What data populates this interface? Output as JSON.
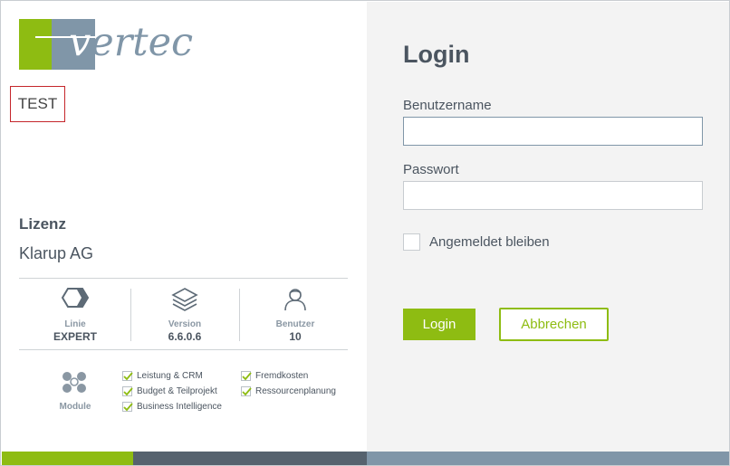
{
  "brand": {
    "wordmark_v": "v",
    "wordmark_rest": "ertec"
  },
  "environment": {
    "label": "TEST"
  },
  "license": {
    "heading": "Lizenz",
    "company": "Klarup AG",
    "stats": [
      {
        "label": "Linie",
        "value": "EXPERT",
        "icon": "hexagon-outline-icon"
      },
      {
        "label": "Version",
        "value": "6.6.0.6",
        "icon": "layers-icon"
      },
      {
        "label": "Benutzer",
        "value": "10",
        "icon": "user-icon"
      }
    ],
    "modules": {
      "label": "Module",
      "icon": "modules-hexagons-icon",
      "items_col1": [
        "Leistung & CRM",
        "Budget & Teilprojekt",
        "Business Intelligence"
      ],
      "items_col2": [
        "Fremdkosten",
        "Ressourcenplanung"
      ]
    }
  },
  "login": {
    "title": "Login",
    "username_label": "Benutzername",
    "username_value": "",
    "password_label": "Passwort",
    "password_value": "",
    "remember_label": "Angemeldet bleiben",
    "remember_checked": false,
    "login_button": "Login",
    "cancel_button": "Abbrechen"
  },
  "colors": {
    "accent_green": "#8ebc12",
    "slate_blue": "#8096a8",
    "dark_slate": "#56626e",
    "text": "#4b5560",
    "test_border": "#c5262b"
  }
}
